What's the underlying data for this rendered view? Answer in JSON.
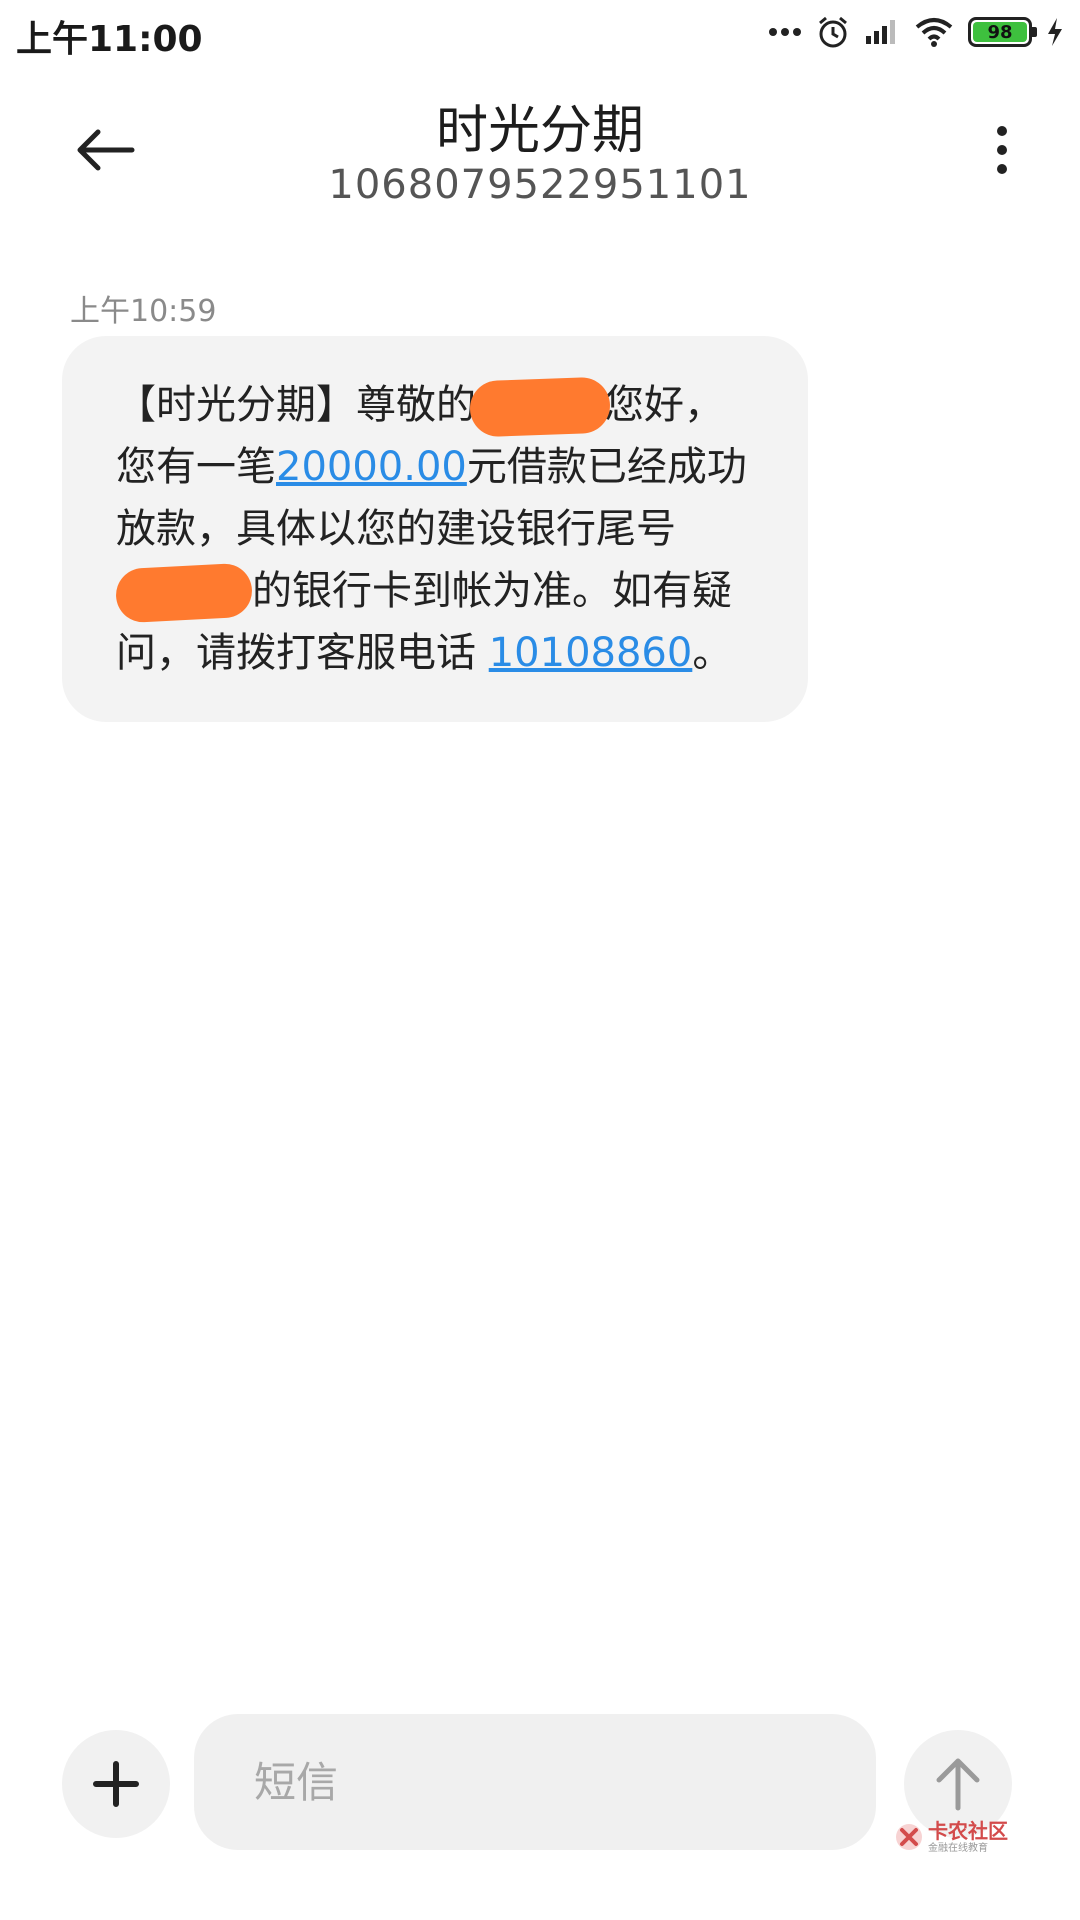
{
  "status_bar": {
    "time": "上午11:00",
    "battery_level": "98",
    "icons": [
      "more-dots-icon",
      "alarm-icon",
      "signal-icon",
      "wifi-icon",
      "battery-icon",
      "charging-icon"
    ]
  },
  "header": {
    "title": "时光分期",
    "phone_number": "1068079522951101"
  },
  "conversation": {
    "messages": [
      {
        "timestamp": "上午10:59",
        "line1_prefix": "【时光分期】尊敬的",
        "line1_suffix": "您好，",
        "line2_prefix": "您有一笔",
        "amount_link": "20000.00",
        "line2_suffix": "元借款已经成功放款，具体以您的建设银行尾号",
        "line3_suffix": "的银行卡到帐为准。如有疑问，请拨打客服电话",
        "phone_link": "10108860",
        "line_end": "。"
      }
    ]
  },
  "input_bar": {
    "placeholder": "短信"
  },
  "watermark": {
    "title": "卡农社区",
    "subtitle": "金融在线教育"
  },
  "colors": {
    "link": "#2a8ce6",
    "bubble": "#f3f3f3",
    "redaction": "#ff7a2f",
    "battery": "#3ec03e"
  }
}
